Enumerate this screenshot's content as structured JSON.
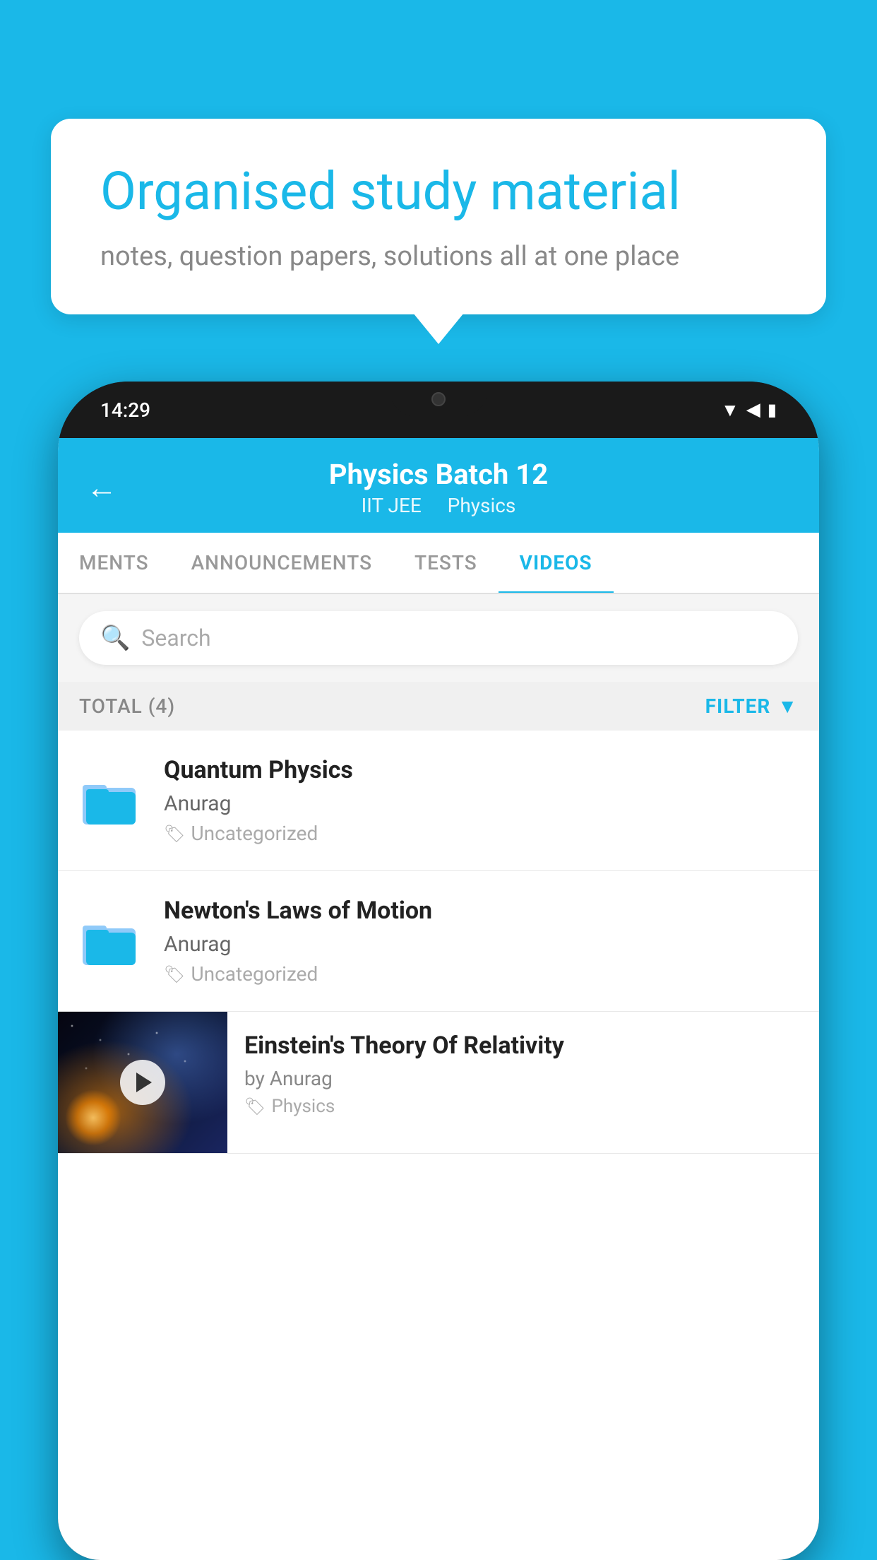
{
  "page": {
    "background_color": "#1ab8e8"
  },
  "bubble": {
    "title": "Organised study material",
    "subtitle": "notes, question papers, solutions all at one place"
  },
  "phone": {
    "time": "14:29",
    "header": {
      "title": "Physics Batch 12",
      "tag1": "IIT JEE",
      "tag2": "Physics"
    },
    "tabs": [
      {
        "label": "MENTS",
        "active": false
      },
      {
        "label": "ANNOUNCEMENTS",
        "active": false
      },
      {
        "label": "TESTS",
        "active": false
      },
      {
        "label": "VIDEOS",
        "active": true
      }
    ],
    "search": {
      "placeholder": "Search"
    },
    "filter": {
      "total_label": "TOTAL (4)",
      "filter_label": "FILTER"
    },
    "videos": [
      {
        "title": "Quantum Physics",
        "author": "Anurag",
        "tag": "Uncategorized",
        "type": "folder"
      },
      {
        "title": "Newton's Laws of Motion",
        "author": "Anurag",
        "tag": "Uncategorized",
        "type": "folder"
      },
      {
        "title": "Einstein's Theory Of Relativity",
        "author": "by Anurag",
        "tag": "Physics",
        "type": "video"
      }
    ]
  }
}
